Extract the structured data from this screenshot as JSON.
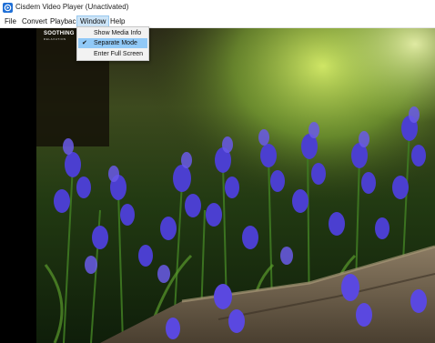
{
  "window": {
    "title": "Cisdem Video Player (Unactivated)",
    "app_icon": "player-app-icon"
  },
  "menubar": {
    "items": [
      {
        "label": "File"
      },
      {
        "label": "Convert"
      },
      {
        "label": "Playback"
      },
      {
        "label": "Window",
        "active": true
      },
      {
        "label": "Help"
      }
    ]
  },
  "window_menu": {
    "items": [
      {
        "label": "Show Media Info",
        "checked": false,
        "highlighted": false
      },
      {
        "label": "Separate Mode",
        "checked": true,
        "highlighted": true
      },
      {
        "label": "Enter Full Screen",
        "checked": false,
        "highlighted": false
      }
    ],
    "check_icon": "checkmark-icon"
  },
  "video": {
    "watermark_title": "SOOTHING",
    "watermark_subtitle": "RELAXATION"
  },
  "colors": {
    "menu_active_bg": "#cce4f7",
    "menu_highlight_bg": "#91c9f7",
    "flower_purple": "#4b3fd0"
  }
}
